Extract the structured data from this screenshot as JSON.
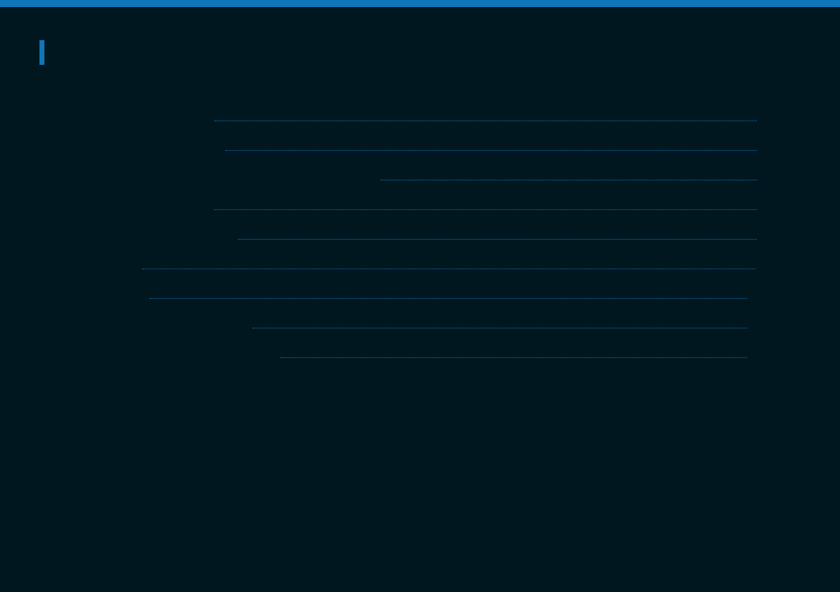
{
  "colors": {
    "background": "#001720",
    "accent": "#0f76b8",
    "leader": "#0f76b8"
  },
  "page": {
    "title": ""
  },
  "toc": {
    "entries": [
      {
        "label": "",
        "page": ""
      },
      {
        "label": "",
        "page": ""
      },
      {
        "label": "",
        "page": ""
      },
      {
        "label": "",
        "page": ""
      },
      {
        "label": "",
        "page": ""
      },
      {
        "label": "",
        "page": ""
      },
      {
        "label": "",
        "page": ""
      },
      {
        "label": "",
        "page": ""
      },
      {
        "label": "",
        "page": ""
      }
    ]
  }
}
